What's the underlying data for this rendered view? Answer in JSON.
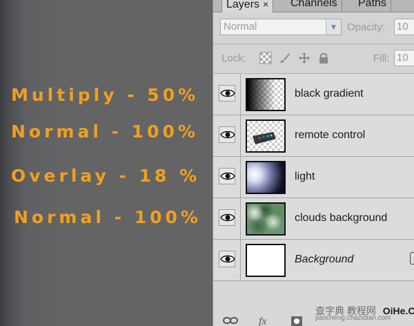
{
  "annotations": [
    {
      "text": "Multiply - 50%"
    },
    {
      "text": "Normal - 100%"
    },
    {
      "text": "Overlay - 18 %"
    },
    {
      "text": "Normal - 100%"
    }
  ],
  "panel": {
    "tabs": [
      {
        "label": "Layers",
        "close": "×",
        "active": true
      },
      {
        "label": "Channels",
        "active": false
      },
      {
        "label": "Paths",
        "active": false
      }
    ],
    "blend_mode": "Normal",
    "opacity_label": "Opacity:",
    "opacity_value": "10",
    "lock_label": "Lock:",
    "fill_label": "Fill:",
    "fill_value": "10",
    "lock_icons": [
      "transparency-lock-icon",
      "brush-lock-icon",
      "move-lock-icon",
      "padlock-icon"
    ]
  },
  "layers": [
    {
      "name": "black gradient",
      "visible": true,
      "thumb": "transparent-gradient"
    },
    {
      "name": "remote control",
      "visible": true,
      "thumb": "remote-on-transparent"
    },
    {
      "name": "light",
      "visible": true,
      "thumb": "light-glow"
    },
    {
      "name": "clouds background",
      "visible": true,
      "thumb": "green-clouds"
    },
    {
      "name": "Background",
      "visible": true,
      "thumb": "white",
      "italic": true,
      "locked": true
    }
  ],
  "watermark": {
    "main": "查字典 教程网",
    "url": "jiaocheng.chazidian.com",
    "corner": "OiHe.COM"
  },
  "bottom_icons": [
    "link-icon",
    "fx-icon",
    "mask-icon"
  ]
}
